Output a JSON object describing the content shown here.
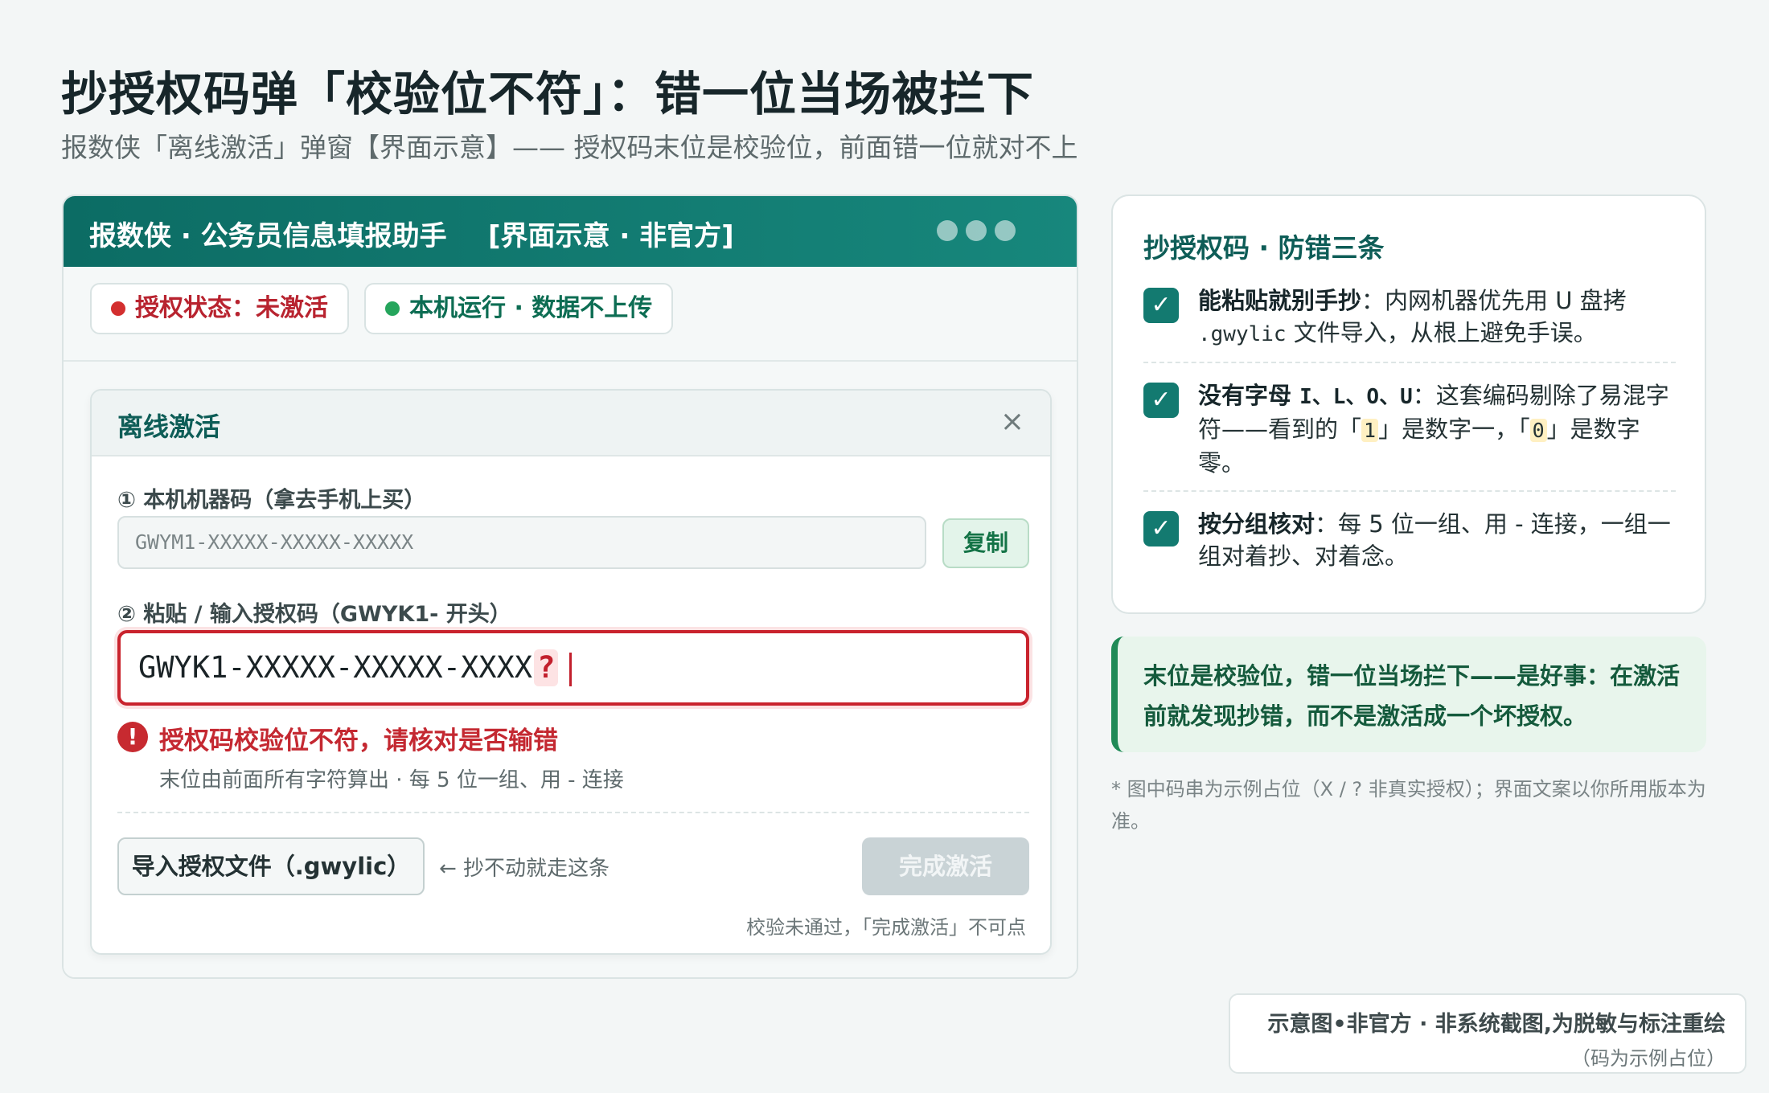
{
  "header": {
    "title": "抄授权码弹「校验位不符」：错一位当场被拦下",
    "subtitle": "报数侠「离线激活」弹窗【界面示意】—— 授权码末位是校验位，前面错一位就对不上"
  },
  "window": {
    "title": "报数侠 · 公务员信息填报助手",
    "tag": "[界面示意 · 非官方]",
    "status": {
      "auth": "授权状态：未激活",
      "local": "本机运行 · 数据不上传"
    }
  },
  "dialog": {
    "title": "离线激活",
    "close": "×",
    "machine_label": "① 本机机器码（拿去手机上买）",
    "machine_code": "GWYM1-XXXXX-XXXXX-XXXXX",
    "copy": "复制",
    "auth_label": "② 粘贴 / 输入授权码（GWYK1- 开头）",
    "auth_value": "GWYK1-XXXXX-XXXXX-XXXX",
    "auth_check_char": "?",
    "error_icon": "!",
    "error": "授权码校验位不符，请核对是否输错",
    "error_hint": "末位由前面所有字符算出 · 每 5 位一组、用 - 连接",
    "import": "导入授权文件（.gwylic）",
    "import_hint": "← 抄不动就走这条",
    "finish": "完成激活",
    "finish_note": "校验未通过，「完成激活」不可点"
  },
  "tips": {
    "title": "抄授权码 · 防错三条",
    "check_icon": "✓",
    "items": [
      {
        "bold": "能粘贴就别手抄",
        "p1": "：内网机器优先用 U 盘拷 ",
        "code": ".gwylic",
        "p2": " 文件导入，从根上避免手误。"
      },
      {
        "bold": "没有字母 ",
        "letters": "I、L、O、U",
        "p1": "：这套编码剔除了易混字符——看到的「",
        "c1": "1",
        "p2": "」是数字一，「",
        "c2": "0",
        "p3": "」是数字零。"
      },
      {
        "bold": "按分组核对",
        "p1": "：每 5 位一组、用 - 连接，一组一组对着抄、对着念。"
      }
    ]
  },
  "callout": "末位是校验位，错一位当场拦下——是好事：在激活前就发现抄错，而不是激活成一个坏授权。",
  "footnote": "* 图中码串为示例占位（X / ? 非真实授权）；界面文案以你所用版本为准。",
  "watermark": {
    "line1": "示意图•非官方 · 非系统截图,为脱敏与标注重绘",
    "line2": "（码为示例占位）"
  },
  "colors": {
    "brand": "#137a70",
    "error": "#c9232d",
    "success": "#25a55c",
    "disabled": "#c9d3d6"
  }
}
